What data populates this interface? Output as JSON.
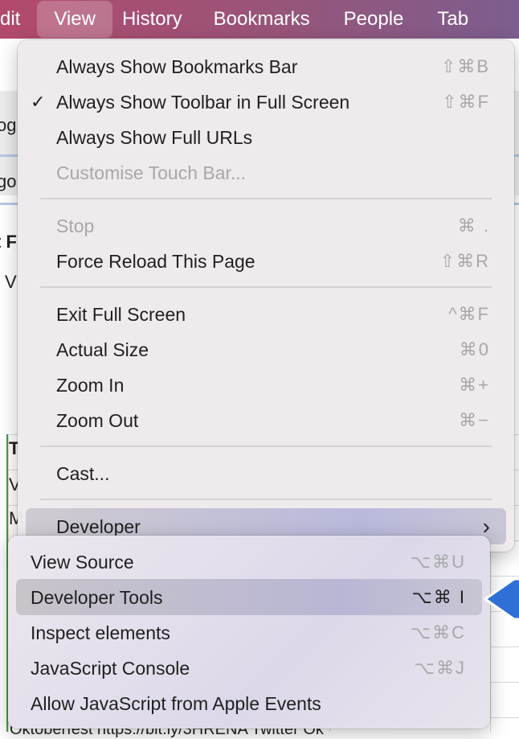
{
  "menubar": {
    "items": [
      "dit",
      "View",
      "History",
      "Bookmarks",
      "People",
      "Tab"
    ],
    "active": "View"
  },
  "background": {
    "t1": "og",
    "t2": "go",
    "t3": "t F",
    "t4": "V",
    "t5": "T",
    "t6": "V",
    "t7": "M",
    "bottom": "Oktoberfest  https://bit.ly/3HRENA  Twitter  Ok"
  },
  "view_menu": {
    "items": [
      {
        "label": "Always Show Bookmarks Bar",
        "shortcut": "⇧⌘B"
      },
      {
        "label": "Always Show Toolbar in Full Screen",
        "shortcut": "⇧⌘F",
        "checked": true,
        "check": "✓"
      },
      {
        "label": "Always Show Full URLs",
        "shortcut": ""
      },
      {
        "label": "Customise Touch Bar...",
        "shortcut": "",
        "disabled": true
      },
      {
        "label": "Stop",
        "shortcut": "⌘ .",
        "disabled": true
      },
      {
        "label": "Force Reload This Page",
        "shortcut": "⇧⌘R"
      },
      {
        "label": "Exit Full Screen",
        "shortcut": "^⌘F"
      },
      {
        "label": "Actual Size",
        "shortcut": "⌘0"
      },
      {
        "label": "Zoom In",
        "shortcut": "⌘+"
      },
      {
        "label": "Zoom Out",
        "shortcut": "⌘−"
      },
      {
        "label": "Cast...",
        "shortcut": ""
      },
      {
        "label": "Developer",
        "submenu": "›",
        "highlighted": true
      }
    ]
  },
  "developer_menu": {
    "items": [
      {
        "label": "View Source",
        "shortcut": "⌥⌘U"
      },
      {
        "label": "Developer Tools",
        "shortcut": "⌥⌘ I",
        "highlighted": true
      },
      {
        "label": "Inspect elements",
        "shortcut": "⌥⌘C"
      },
      {
        "label": "JavaScript Console",
        "shortcut": "⌥⌘J"
      },
      {
        "label": "Allow JavaScript from Apple Events",
        "shortcut": ""
      }
    ]
  },
  "colors": {
    "accent_arrow": "#2f6fd6",
    "menubar_start": "#b24a6c",
    "menubar_end": "#7c5e8e"
  }
}
